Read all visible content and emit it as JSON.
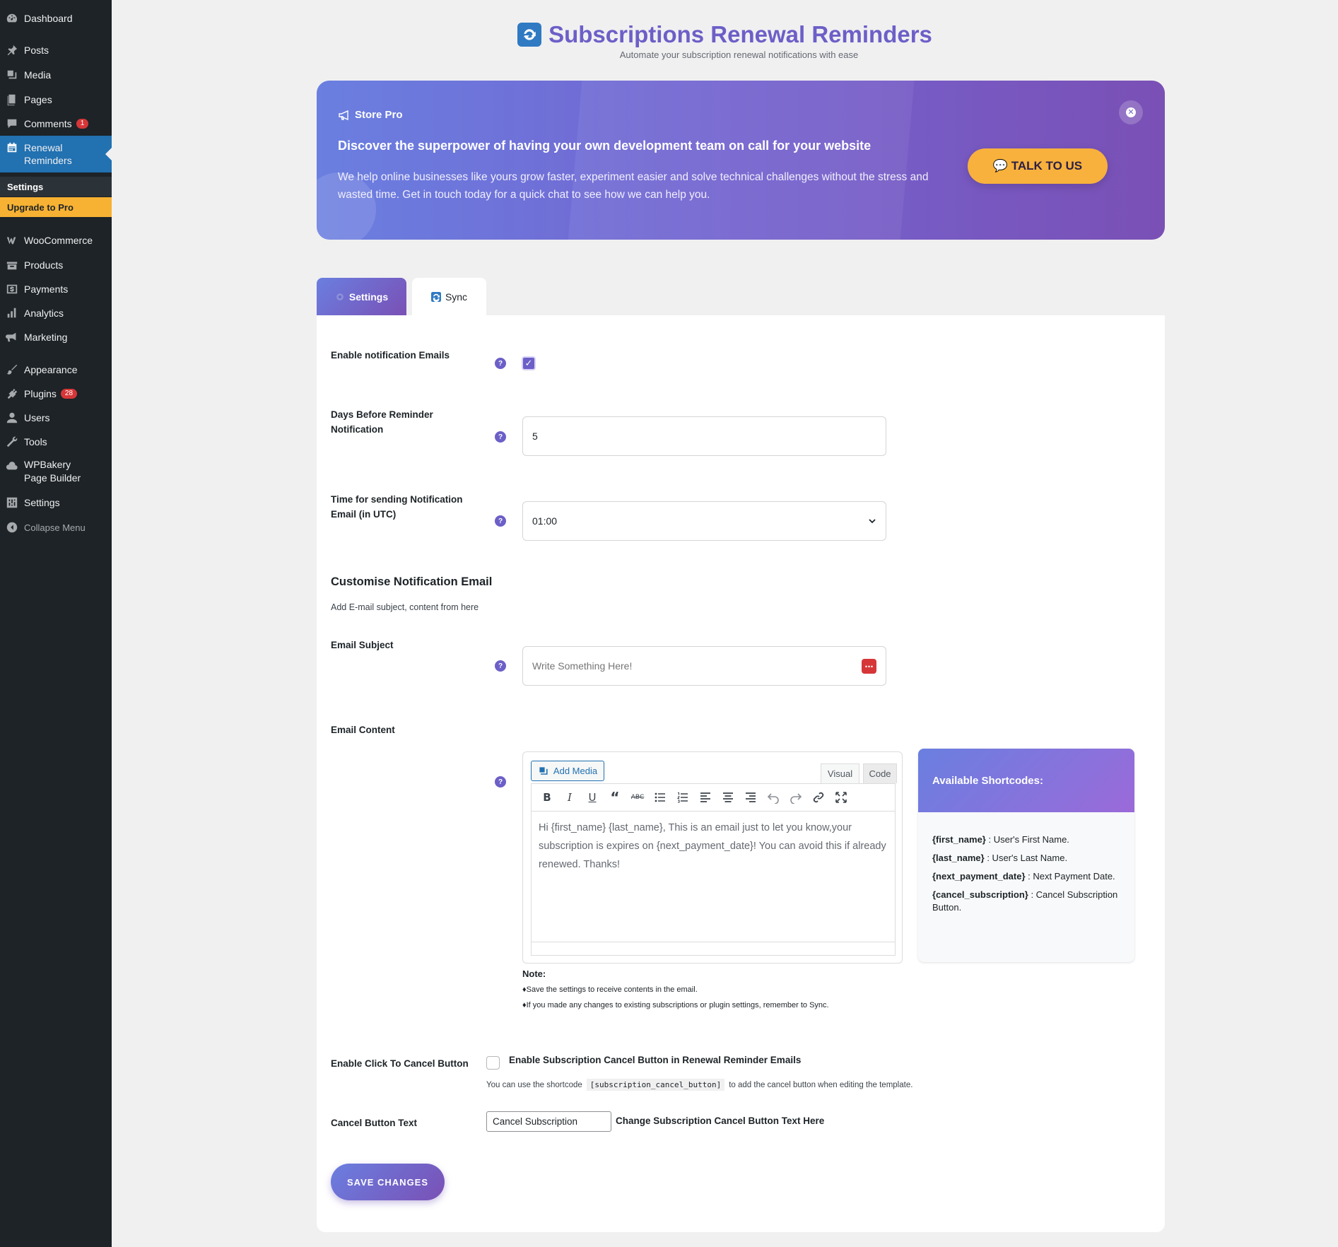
{
  "sidebar": {
    "items": [
      {
        "label": "Dashboard",
        "icon": "dashboard-icon"
      },
      {
        "label": "Posts",
        "icon": "pin-icon"
      },
      {
        "label": "Media",
        "icon": "media-icon"
      },
      {
        "label": "Pages",
        "icon": "pages-icon"
      },
      {
        "label": "Comments",
        "icon": "comment-icon",
        "badge": "1"
      },
      {
        "label": "Renewal Reminders",
        "icon": "calendar-icon"
      },
      {
        "label": "WooCommerce",
        "icon": "woo-icon"
      },
      {
        "label": "Products",
        "icon": "products-icon"
      },
      {
        "label": "Payments",
        "icon": "payments-icon"
      },
      {
        "label": "Analytics",
        "icon": "analytics-icon"
      },
      {
        "label": "Marketing",
        "icon": "megaphone-icon"
      },
      {
        "label": "Appearance",
        "icon": "brush-icon"
      },
      {
        "label": "Plugins",
        "icon": "plugin-icon",
        "badge": "28"
      },
      {
        "label": "Users",
        "icon": "user-icon"
      },
      {
        "label": "Tools",
        "icon": "wrench-icon"
      },
      {
        "label": "WPBakery Page Builder",
        "icon": "cloud-icon"
      },
      {
        "label": "Settings",
        "icon": "settings-icon"
      },
      {
        "label": "Collapse Menu",
        "icon": "collapse-icon"
      }
    ],
    "submenu": {
      "settings": "Settings",
      "upgrade": "Upgrade to Pro"
    },
    "accent": "#2271b1"
  },
  "header": {
    "title": "Subscriptions Renewal Reminders",
    "subtitle": "Automate your subscription renewal notifications with ease",
    "title_color": "#6c5fc7"
  },
  "promo": {
    "brand": "Store Pro",
    "headline": "Discover the superpower of having your own development team on call for your website",
    "body": "We help online businesses like yours grow faster, experiment easier and solve technical challenges without the stress and wasted time. Get in touch today for a quick chat to see how we can help you.",
    "cta": "💬 TALK TO US",
    "cta_color": "#f8b13c"
  },
  "tabs": [
    {
      "label": "Settings",
      "active": true
    },
    {
      "label": "Sync",
      "active": false
    }
  ],
  "form": {
    "enable_emails": {
      "label": "Enable notification Emails",
      "checked": true
    },
    "days_before": {
      "label": "Days Before Reminder Notification",
      "value": "5"
    },
    "send_time": {
      "label": "Time for sending Notification Email (in UTC)",
      "value": "01:00"
    },
    "section_title": "Customise Notification Email",
    "section_subtitle": "Add E-mail subject, content from here",
    "subject": {
      "label": "Email Subject",
      "placeholder": "Write Something Here!"
    },
    "content": {
      "label": "Email Content",
      "add_media": "Add Media",
      "tab_visual": "Visual",
      "tab_code": "Code",
      "body": "Hi {first_name} {last_name}, This is an email just to let you know,your subscription is expires on {next_payment_date}! You can avoid this if already renewed. Thanks!"
    },
    "shortcodes": {
      "title": "Available Shortcodes:",
      "items": [
        {
          "code": "{first_name}",
          "desc": " : User's First Name."
        },
        {
          "code": "{last_name}",
          "desc": " : User's Last Name."
        },
        {
          "code": "{next_payment_date}",
          "desc": " : Next Payment Date."
        },
        {
          "code": "{cancel_subscription}",
          "desc": " : Cancel Subscription Button."
        }
      ]
    },
    "note": {
      "title": "Note:",
      "line1": "♦Save the settings to receive contents in the email.",
      "line2": "♦If you made any changes to existing subscriptions or plugin settings, remember to Sync."
    },
    "cancel_button": {
      "label": "Enable Click To Cancel Button",
      "checkbox_label": "Enable Subscription Cancel Button in Renewal Reminder Emails",
      "checked": false,
      "help_before": "You can use the shortcode",
      "help_code": "[subscription_cancel_button]",
      "help_after": "to add the cancel button when editing the template."
    },
    "cancel_text": {
      "label": "Cancel Button Text",
      "value": "Cancel Subscription",
      "hint": "Change Subscription Cancel Button Text Here"
    },
    "save": "SAVE CHANGES"
  }
}
